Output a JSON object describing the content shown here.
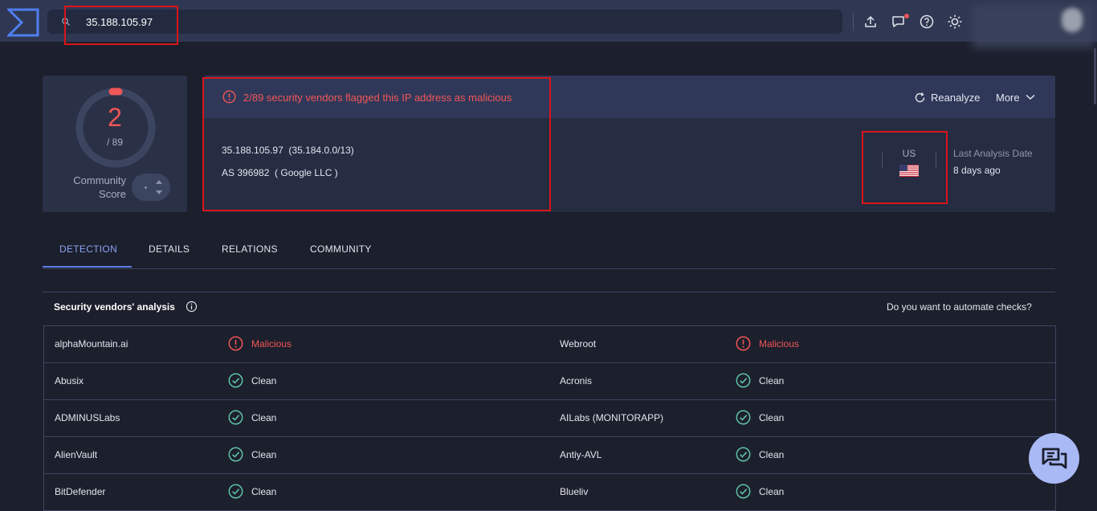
{
  "search": {
    "value": "35.188.105.97",
    "placeholder": ""
  },
  "score": {
    "value": "2",
    "total": "/ 89",
    "community_label_1": "Community",
    "community_label_2": "Score"
  },
  "header": {
    "alert": "2/89 security vendors flagged this IP address as malicious",
    "reanalyze": "Reanalyze",
    "more": "More"
  },
  "ip": {
    "line": "35.188.105.97  (35.184.0.0/13)",
    "as_line": "AS 396982  ( Google LLC )",
    "country": "US",
    "last_analysis_label": "Last Analysis Date",
    "last_analysis_value": "8 days ago"
  },
  "tabs": [
    "DETECTION",
    "DETAILS",
    "RELATIONS",
    "COMMUNITY"
  ],
  "vendors_section": {
    "title": "Security vendors' analysis",
    "automate": "Do you want to automate checks?"
  },
  "vendors": [
    {
      "left": {
        "name": "alphaMountain.ai",
        "status": "Malicious"
      },
      "right": {
        "name": "Webroot",
        "status": "Malicious"
      }
    },
    {
      "left": {
        "name": "Abusix",
        "status": "Clean"
      },
      "right": {
        "name": "Acronis",
        "status": "Clean"
      }
    },
    {
      "left": {
        "name": "ADMINUSLabs",
        "status": "Clean"
      },
      "right": {
        "name": "AILabs (MONITORAPP)",
        "status": "Clean"
      }
    },
    {
      "left": {
        "name": "AlienVault",
        "status": "Clean"
      },
      "right": {
        "name": "Antiy-AVL",
        "status": "Clean"
      }
    },
    {
      "left": {
        "name": "BitDefender",
        "status": "Clean"
      },
      "right": {
        "name": "Blueliv",
        "status": "Clean"
      }
    }
  ],
  "colors": {
    "malicious": "#f05656",
    "clean": "#5fc2a8",
    "accent": "#8ba3f5",
    "topbar": "#2f3752"
  },
  "icons": [
    "logo-icon",
    "search-icon",
    "upload-icon",
    "chat-icon",
    "help-icon",
    "theme-icon",
    "alert-icon",
    "reanalyze-icon",
    "chevron-down-icon",
    "info-icon",
    "malicious-icon",
    "clean-icon",
    "chat-fab-icon",
    "us-flag-icon"
  ]
}
